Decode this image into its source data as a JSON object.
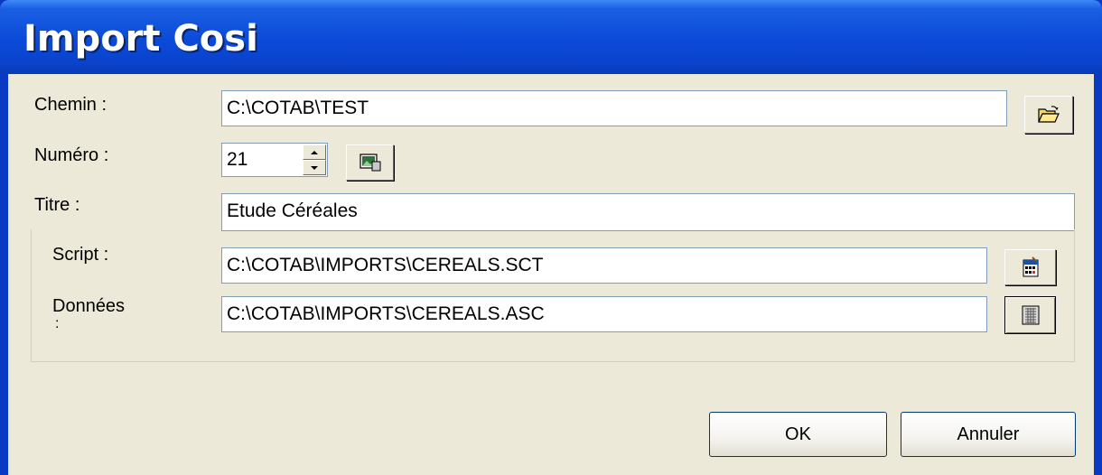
{
  "window": {
    "title": "Import Cosi"
  },
  "form": {
    "chemin": {
      "label": "Chemin :",
      "value": "C:\\COTAB\\TEST"
    },
    "numero": {
      "label": "Numéro :",
      "value": "21"
    },
    "titre": {
      "label": "Titre :",
      "value": "Etude Céréales"
    },
    "script": {
      "label": "Script :",
      "value": "C:\\COTAB\\IMPORTS\\CEREALS.SCT"
    },
    "donnees": {
      "label": "Données",
      "label_cont": ":",
      "value": "C:\\COTAB\\IMPORTS\\CEREALS.ASC"
    }
  },
  "buttons": {
    "ok": "OK",
    "cancel": "Annuler"
  },
  "icons": {
    "browse_folder": "open-folder-icon",
    "numero_action": "image-icon",
    "script_browse": "script-file-icon",
    "data_browse": "data-grid-icon"
  },
  "colors": {
    "titlebar": "#0b4ad8",
    "client": "#ece9d8",
    "field_border": "#7f9db9"
  }
}
